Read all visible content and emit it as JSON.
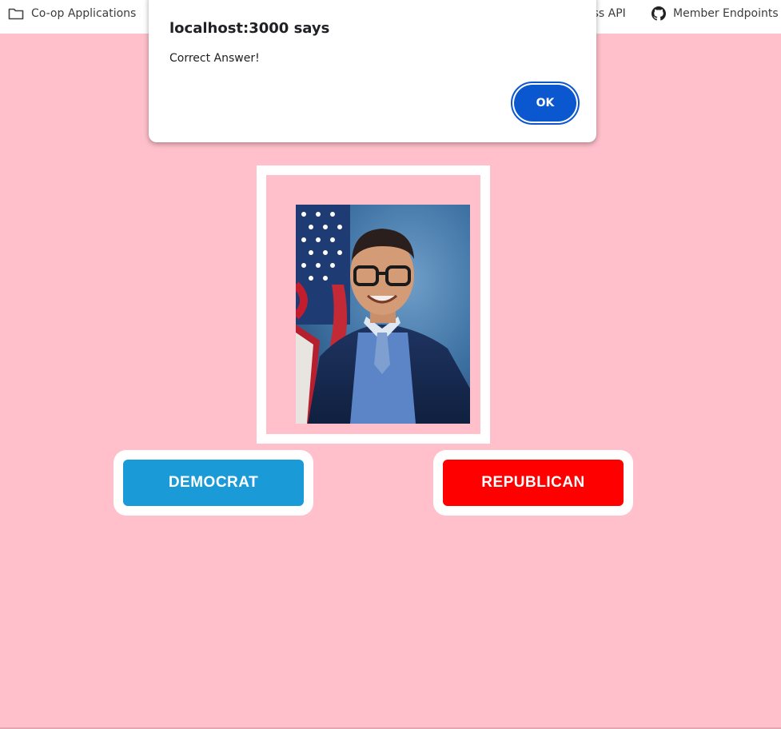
{
  "bookmarks": [
    {
      "label": "Co-op Applications",
      "icon": "folder-icon"
    },
    {
      "label": "ess API"
    },
    {
      "label": "Member Endpoints",
      "icon": "github-icon"
    }
  ],
  "dialog": {
    "title": "localhost:3000 says",
    "message": "Correct Answer!",
    "ok_label": "OK"
  },
  "quiz": {
    "portrait_alt": "portrait-photo",
    "buttons": {
      "democrat": "DEMOCRAT",
      "republican": "REPUBLICAN"
    }
  },
  "colors": {
    "background": "#ffc0cb",
    "democrat": "#1a9bd7",
    "republican": "#ff0000",
    "dialog_accent": "#0b57d0"
  }
}
